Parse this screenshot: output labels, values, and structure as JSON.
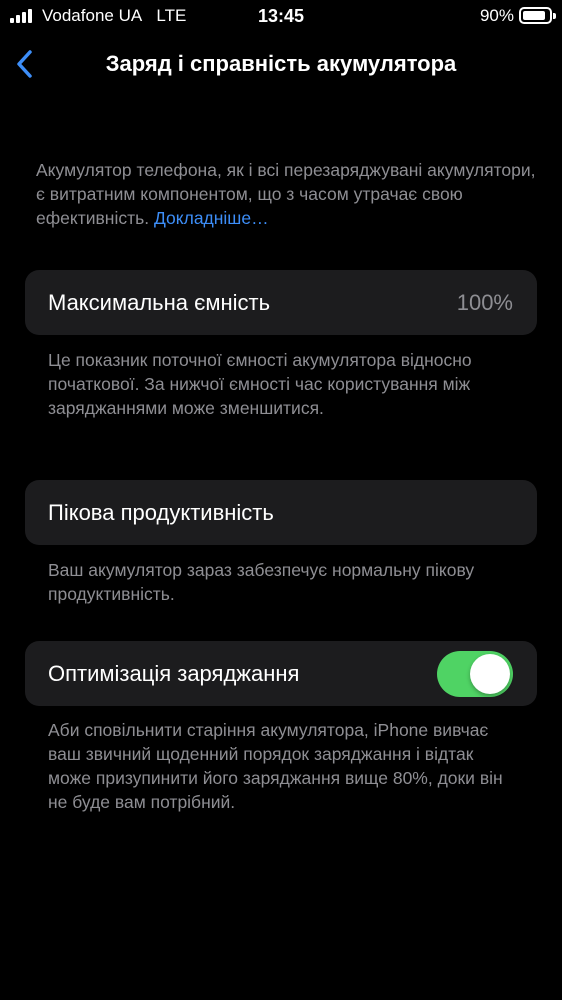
{
  "status_bar": {
    "carrier": "Vodafone UA",
    "network": "LTE",
    "time": "13:45",
    "battery_percent": "90%",
    "battery_level": 0.9
  },
  "nav": {
    "back_icon": "chevron-left-icon",
    "title": "Заряд і справність акумулятора"
  },
  "intro": {
    "text": "Акумулятор телефона, як і всі перезаряджувані акумулятори, є витратним компонентом, що з часом утрачає свою ефективність. ",
    "link": "Докладніше…"
  },
  "max_capacity": {
    "label": "Максимальна ємність",
    "value": "100%",
    "footnote": "Це показник поточної ємності акумулятора відносно початкової. За нижчої ємності час користування між заряджаннями може зменшитися."
  },
  "peak_performance": {
    "label": "Пікова продуктивність",
    "footnote": "Ваш акумулятор зараз забезпечує нормальну пікову продуктивність."
  },
  "optimized_charging": {
    "label": "Оптимізація заряджання",
    "enabled": true,
    "footnote": "Аби сповільнити старіння акумулятора, iPhone вивчає ваш звичний щоденний порядок заряджання і відтак може призупинити його заряджання вище 80%, доки він не буде вам потрібний."
  },
  "colors": {
    "background": "#000000",
    "card": "#1c1c1e",
    "secondary_text": "#8e8e93",
    "link": "#3d8ef8",
    "toggle_on": "#4fd364"
  }
}
